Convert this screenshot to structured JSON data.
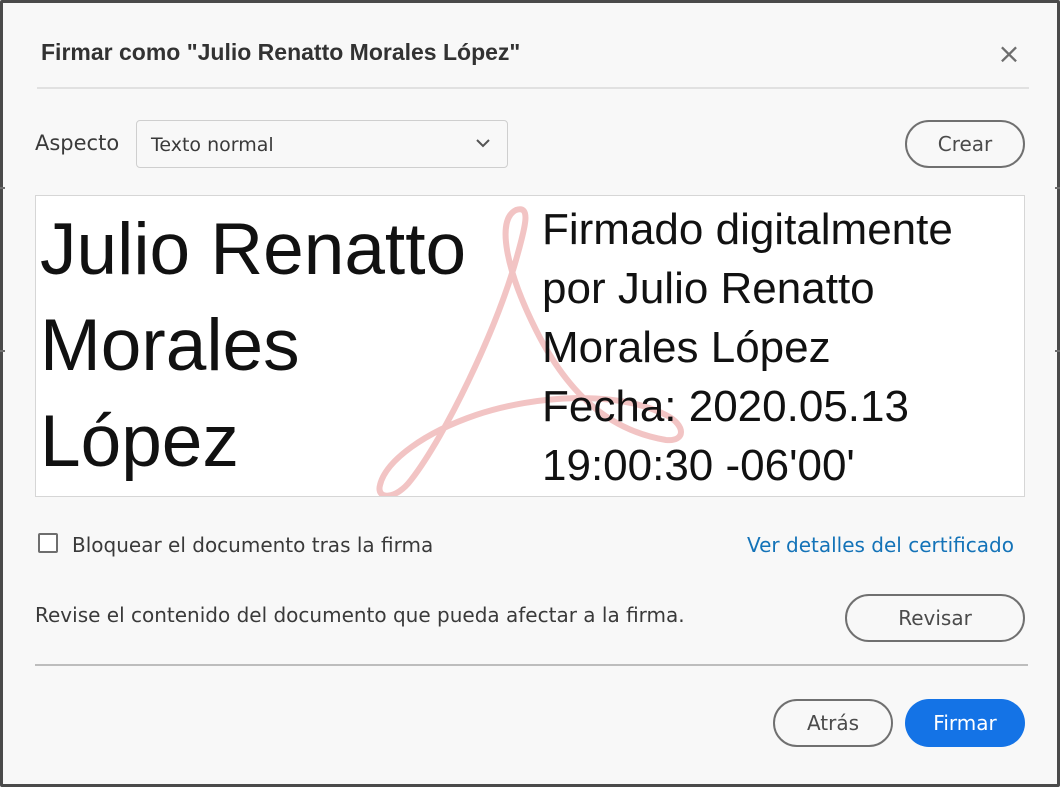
{
  "dialog": {
    "title": "Firmar como \"Julio Renatto Morales López\"",
    "close_icon": "close-icon"
  },
  "appearance": {
    "label": "Aspecto",
    "selected": "Texto normal",
    "create_label": "Crear"
  },
  "signature_preview": {
    "name_lines": [
      "Julio Renatto",
      "Morales",
      "López"
    ],
    "detail_lines": [
      "Firmado digitalmente",
      "por Julio Renatto",
      "Morales López",
      "Fecha: 2020.05.13",
      "19:00:30 -06'00'"
    ],
    "watermark_icon": "acrobat-logo-watermark",
    "watermark_color": "#f2c4c4"
  },
  "options": {
    "lock_label": "Bloquear el documento tras la firma",
    "lock_checked": false,
    "certificate_link": "Ver detalles del certificado"
  },
  "review": {
    "text": "Revise el contenido del documento que pueda afectar a la firma.",
    "button_label": "Revisar"
  },
  "footer": {
    "back_label": "Atrás",
    "sign_label": "Firmar"
  },
  "colors": {
    "primary": "#1473e6",
    "link": "#1473b8"
  }
}
